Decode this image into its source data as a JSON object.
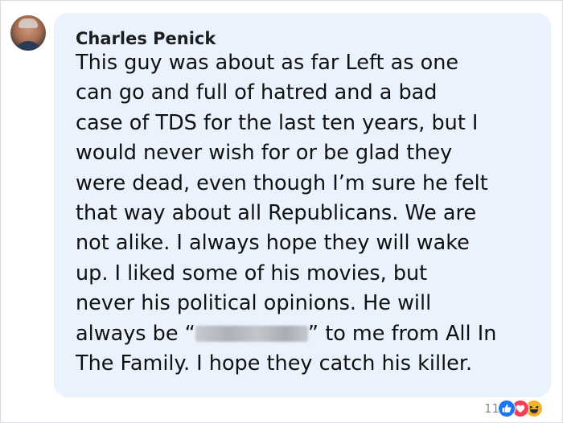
{
  "comment": {
    "author": "Charles Penick",
    "lines": [
      "This guy was about as far Left as one",
      "can go and full of hatred and a bad",
      "case of TDS for the last ten years, but I",
      "would never wish for or be glad they",
      "were dead, even though I’m sure he felt",
      "that way about all Republicans. We are",
      "not alike. I always hope they will wake",
      "up. I liked some of his movies, but",
      "never his political opinions. He will"
    ],
    "line_10_before": "always be “",
    "line_10_after": "” to me from All In",
    "line_11": "The Family. I hope they catch his killer."
  },
  "reactions": {
    "count": "11",
    "icons": [
      "like-icon",
      "love-icon",
      "haha-icon"
    ],
    "colors": {
      "like": "#1877f2",
      "love": "#f33e58",
      "haha": "#f7b125"
    }
  },
  "colors": {
    "bubble": "#eaf2fd",
    "text": "#111111",
    "author": "#1c1e21",
    "count": "#8a8d91"
  }
}
